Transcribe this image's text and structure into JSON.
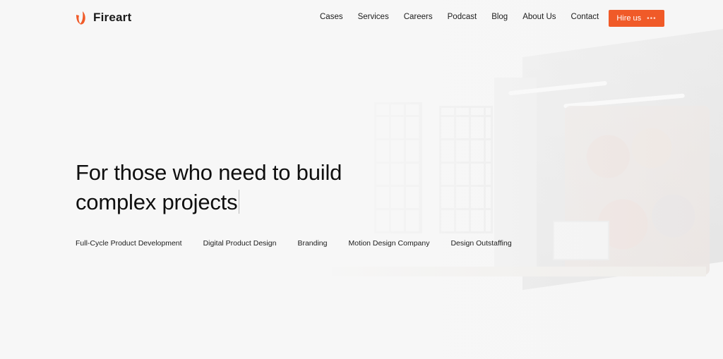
{
  "brand": {
    "name": "Fireart",
    "accent": "#f05a28"
  },
  "nav": {
    "items": [
      {
        "label": "Cases"
      },
      {
        "label": "Services"
      },
      {
        "label": "Careers"
      },
      {
        "label": "Podcast"
      },
      {
        "label": "Blog"
      },
      {
        "label": "About Us"
      },
      {
        "label": "Contact"
      }
    ],
    "cta_label": "Hire us",
    "cta_dots": "•••"
  },
  "hero": {
    "line1": "For those who need to build",
    "line2": "complex projects"
  },
  "services": [
    {
      "label": "Full-Cycle Product Development"
    },
    {
      "label": "Digital Product Design"
    },
    {
      "label": "Branding"
    },
    {
      "label": "Motion Design Company"
    },
    {
      "label": "Design Outstaffing"
    }
  ]
}
